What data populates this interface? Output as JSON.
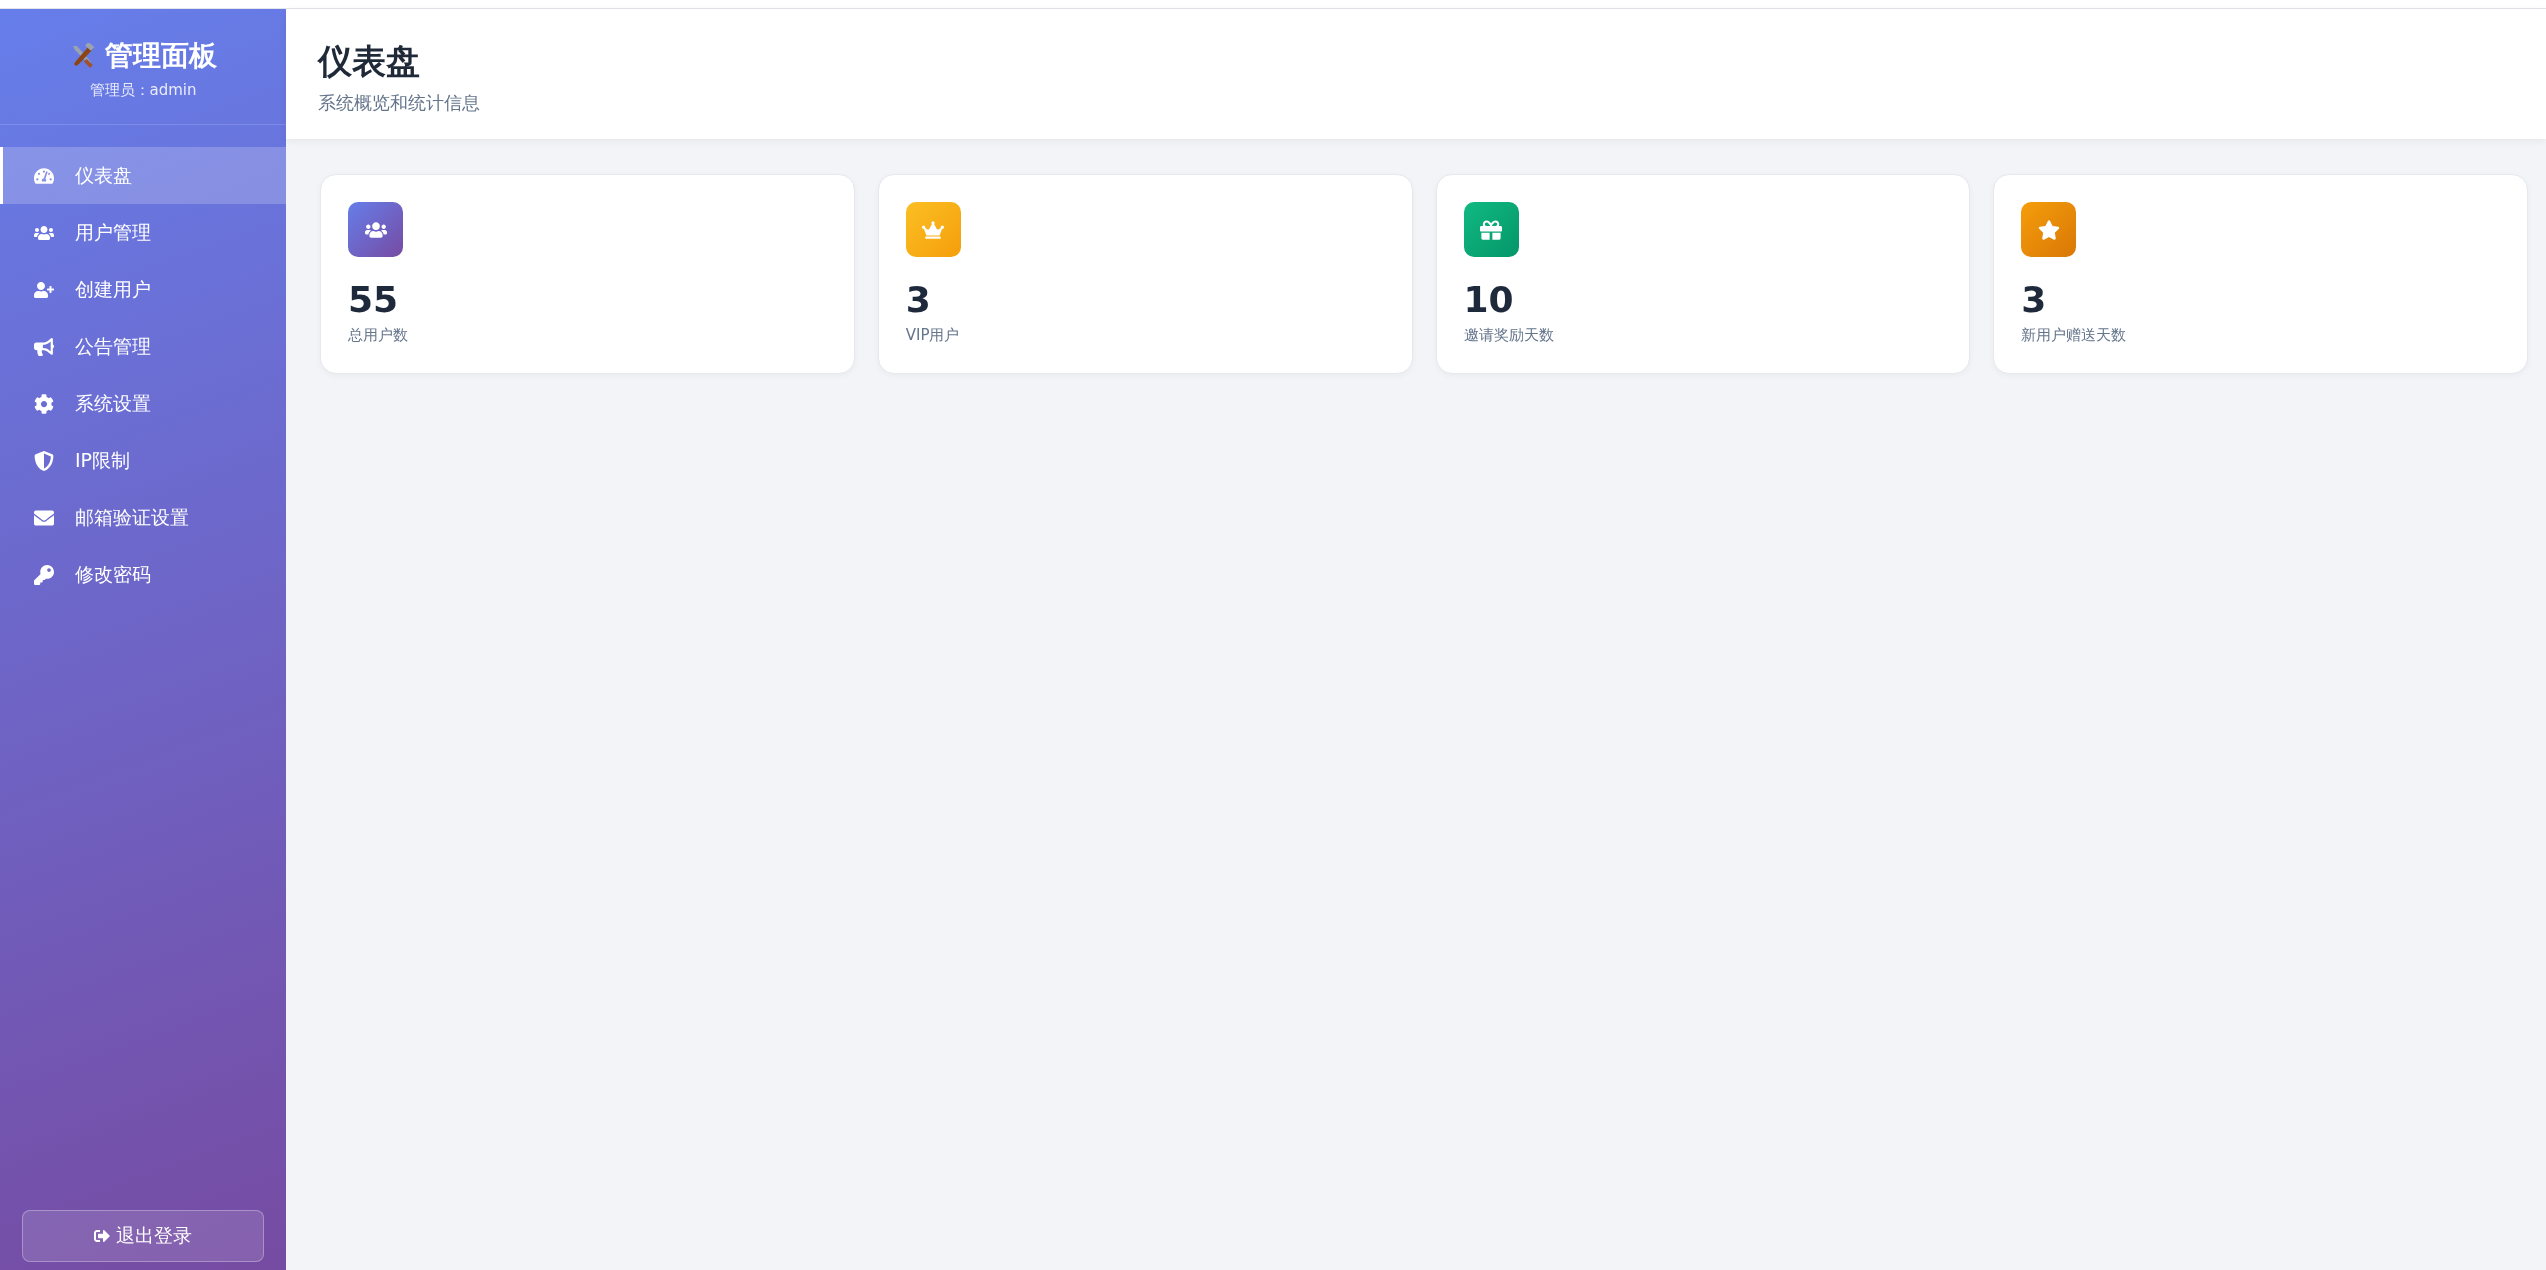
{
  "sidebar": {
    "title": "管理面板",
    "subtitle": "管理员：admin",
    "items": [
      {
        "label": "仪表盘",
        "selected": true
      },
      {
        "label": "用户管理",
        "selected": false
      },
      {
        "label": "创建用户",
        "selected": false
      },
      {
        "label": "公告管理",
        "selected": false
      },
      {
        "label": "系统设置",
        "selected": false
      },
      {
        "label": "IP限制",
        "selected": false
      },
      {
        "label": "邮箱验证设置",
        "selected": false
      },
      {
        "label": "修改密码",
        "selected": false
      }
    ],
    "logout": "退出登录"
  },
  "header": {
    "title": "仪表盘",
    "subtitle": "系统概览和统计信息"
  },
  "stats": [
    {
      "value": "55",
      "label": "总用户数"
    },
    {
      "value": "3",
      "label": "VIP用户"
    },
    {
      "value": "10",
      "label": "邀请奖励天数"
    },
    {
      "value": "3",
      "label": "新用户赠送天数"
    }
  ]
}
